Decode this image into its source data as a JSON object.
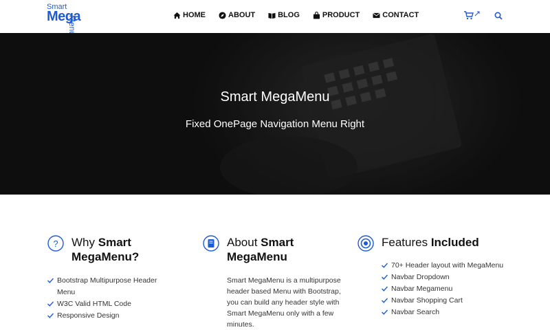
{
  "logo": {
    "line1": "Smart",
    "line2": "Mega",
    "line3": "Menu"
  },
  "nav": {
    "items": [
      {
        "label": "HOME",
        "icon": "home-icon"
      },
      {
        "label": "ABOUT",
        "icon": "compass-icon"
      },
      {
        "label": "BLOG",
        "icon": "book-icon"
      },
      {
        "label": "PRODUCT",
        "icon": "bag-icon"
      },
      {
        "label": "CONTACT",
        "icon": "envelope-icon"
      }
    ],
    "cart_icon": "cart-icon",
    "search_icon": "search-icon"
  },
  "hero": {
    "title": "Smart MegaMenu",
    "subtitle": "Fixed OnePage Navigation Menu Right"
  },
  "columns": {
    "why": {
      "title_plain": "Why ",
      "title_bold": "Smart MegaMenu?",
      "icon": "question-icon",
      "items": [
        "Bootstrap Multipurpose Header Menu",
        "W3C Valid HTML Code",
        "Responsive Design"
      ]
    },
    "about": {
      "title_plain": "About ",
      "title_bold": "Smart MegaMenu",
      "icon": "book-icon",
      "text": "Smart MegaMenu is a multipurpose header based Menu with Bootstrap, you can build any header style with Smart MegaMenu only with a few minutes."
    },
    "features": {
      "title_plain": "Features ",
      "title_bold": "Included",
      "icon": "target-icon",
      "items": [
        "70+ Header layout with MegaMenu",
        "Navbar Dropdown",
        "Navbar Megamenu",
        "Navbar Shopping Cart",
        "Navbar Search"
      ]
    }
  },
  "colors": {
    "accent": "#1e5bd6"
  }
}
